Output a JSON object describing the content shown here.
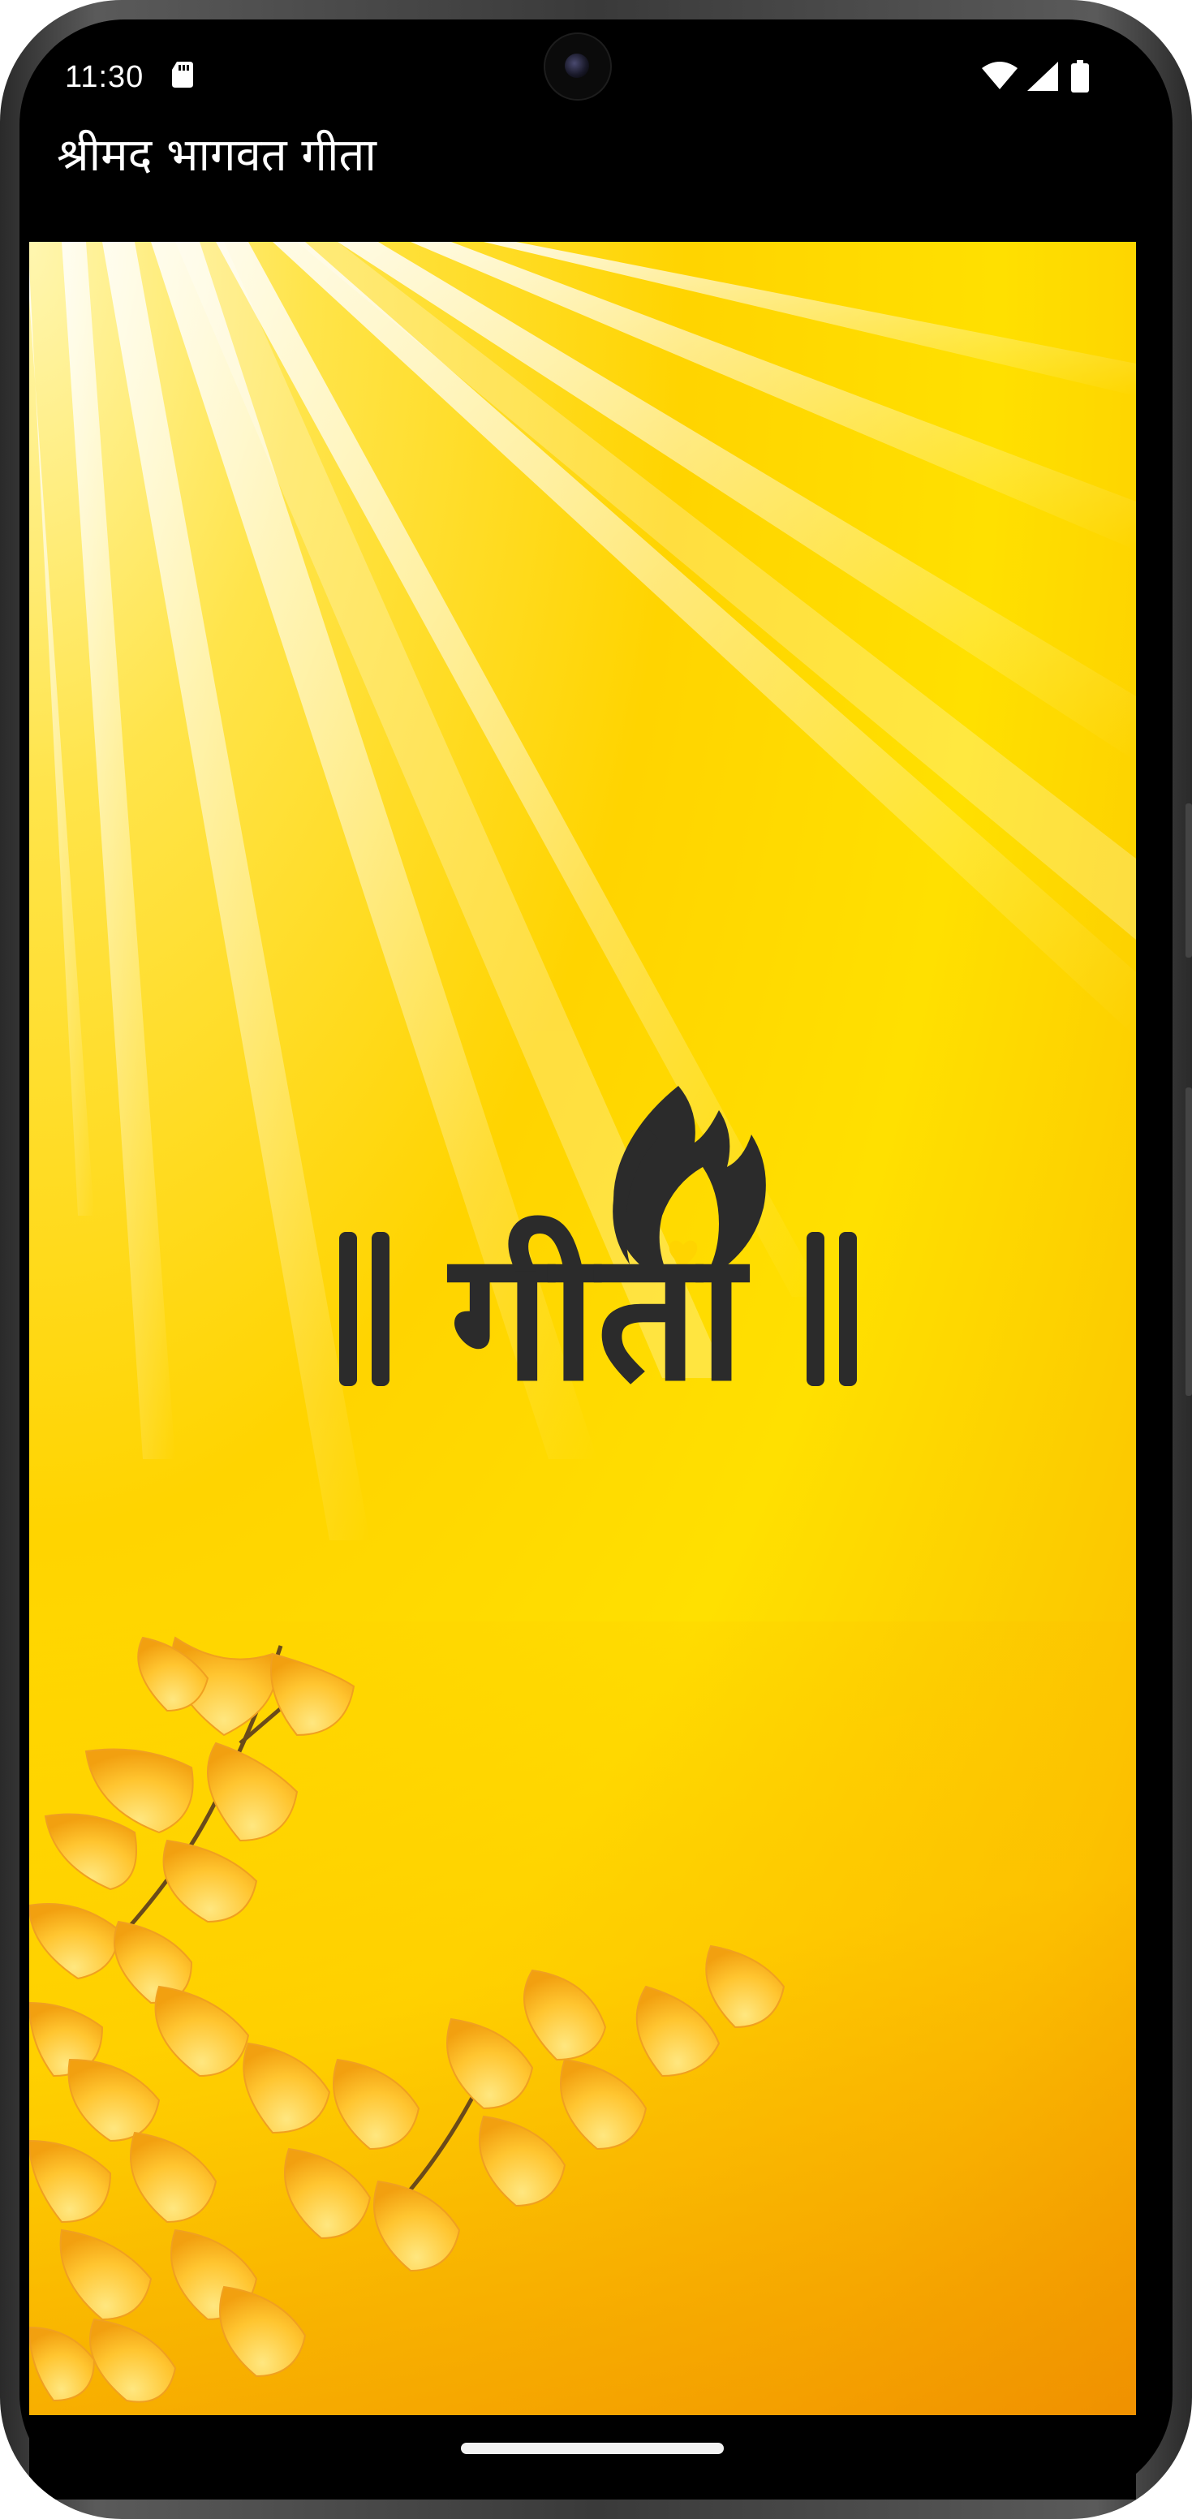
{
  "status_bar": {
    "time": "11:30",
    "icons": [
      "sd-card-icon",
      "wifi-icon",
      "cellular-signal-icon",
      "battery-icon"
    ]
  },
  "app_bar": {
    "title": "श्रीमद भागवत गीता"
  },
  "splash": {
    "logo_text": "।।गीता।।",
    "background": "sun-rays-with-ginkgo-flowers",
    "colors": {
      "primary_yellow": "#ffd400",
      "light_yellow": "#fff6b0",
      "orange": "#f0a000",
      "logo_dark": "#2b2b2b"
    }
  },
  "nav": {
    "indicator": "home-indicator"
  }
}
